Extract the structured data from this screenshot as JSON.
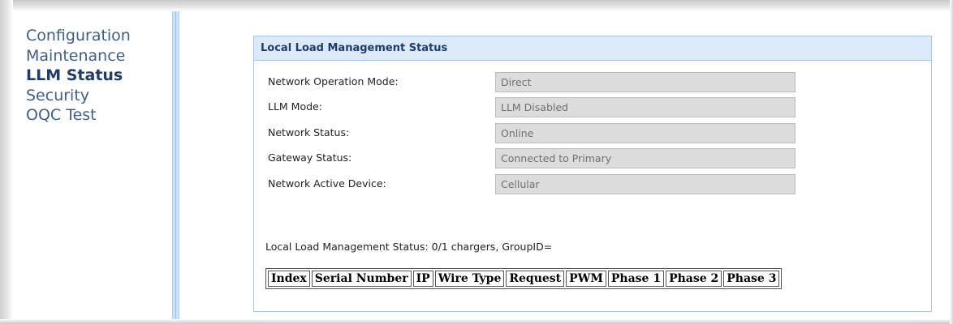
{
  "nav": {
    "items": [
      {
        "label": "Configuration",
        "active": false
      },
      {
        "label": "Maintenance",
        "active": false
      },
      {
        "label": "LLM Status",
        "active": true
      },
      {
        "label": "Security",
        "active": false
      },
      {
        "label": "OQC Test",
        "active": false
      }
    ]
  },
  "panel": {
    "title": "Local Load Management Status",
    "fields": [
      {
        "label": "Network Operation Mode:",
        "value": "Direct"
      },
      {
        "label": "LLM Mode:",
        "value": "LLM Disabled"
      },
      {
        "label": "Network Status:",
        "value": "Online"
      },
      {
        "label": "Gateway Status:",
        "value": "Connected to Primary"
      },
      {
        "label": "Network Active Device:",
        "value": "Cellular"
      }
    ],
    "summary": "Local Load Management Status: 0/1 chargers, GroupID=",
    "table": {
      "headers": [
        "Index",
        "Serial Number",
        "IP",
        "Wire Type",
        "Request",
        "PWM",
        "Phase 1",
        "Phase 2",
        "Phase 3"
      ]
    }
  }
}
